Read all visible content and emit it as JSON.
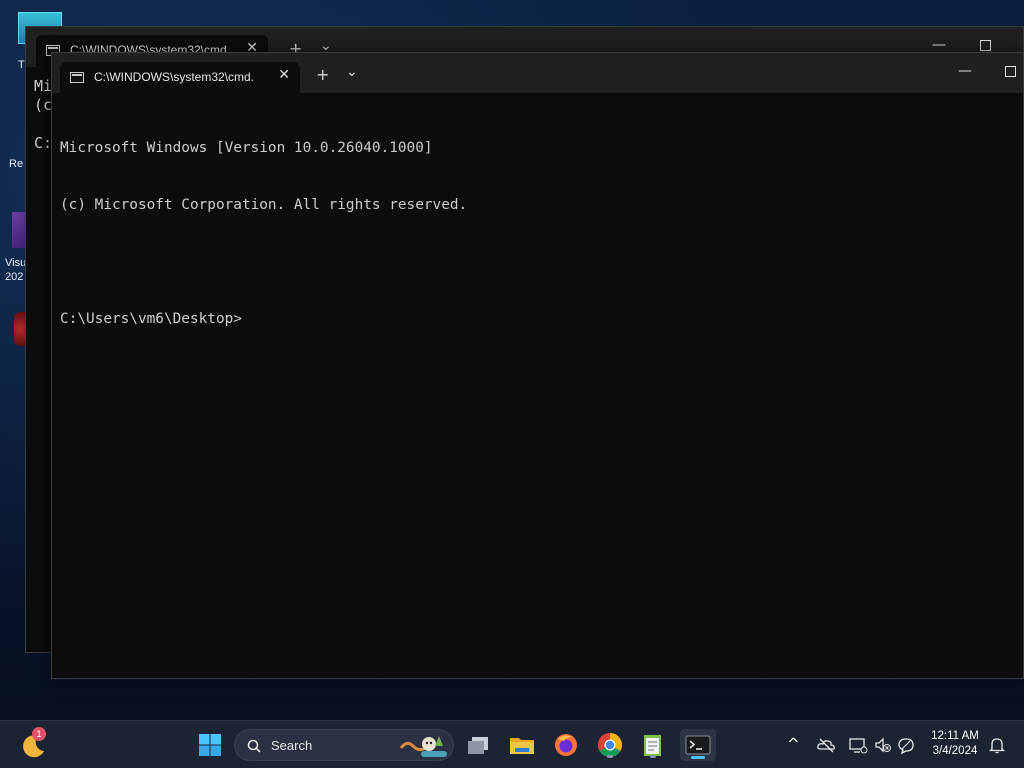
{
  "desktop": {
    "icons": [
      {
        "label": "T"
      },
      {
        "label": "Re"
      },
      {
        "label": "Visu"
      },
      {
        "label": "202"
      }
    ]
  },
  "back_window": {
    "tab_title": "C:\\WINDOWS\\system32\\cmd.",
    "new_tab": "+",
    "dropdown": "⌄",
    "lines": [
      "Mi",
      "(c",
      "",
      "C:"
    ]
  },
  "front_window": {
    "tab_title": "C:\\WINDOWS\\system32\\cmd.",
    "close_tab": "✕",
    "new_tab": "+",
    "dropdown": "⌄",
    "minimize": "—",
    "terminal_lines": [
      "Microsoft Windows [Version 10.0.26040.1000]",
      "(c) Microsoft Corporation. All rights reserved.",
      "",
      "C:\\Users\\vm6\\Desktop>"
    ]
  },
  "taskbar": {
    "search_placeholder": "Search",
    "notification_badge": "1",
    "pinned": [
      {
        "icon": "windows-start-icon"
      },
      {
        "icon": "task-view-icon"
      },
      {
        "icon": "file-explorer-icon"
      },
      {
        "icon": "firefox-icon"
      },
      {
        "icon": "chrome-icon"
      },
      {
        "icon": "notepad-icon"
      },
      {
        "icon": "terminal-icon"
      }
    ],
    "tray": {
      "chevron": "^",
      "time": "12:11 AM",
      "date": "3/4/2024"
    }
  },
  "colors": {
    "accent": "#4cc2ff",
    "terminal_bg": "#0c0c0c",
    "terminal_fg": "#cccccc",
    "titlebar": "#202020",
    "taskbar": "#1c2333"
  }
}
